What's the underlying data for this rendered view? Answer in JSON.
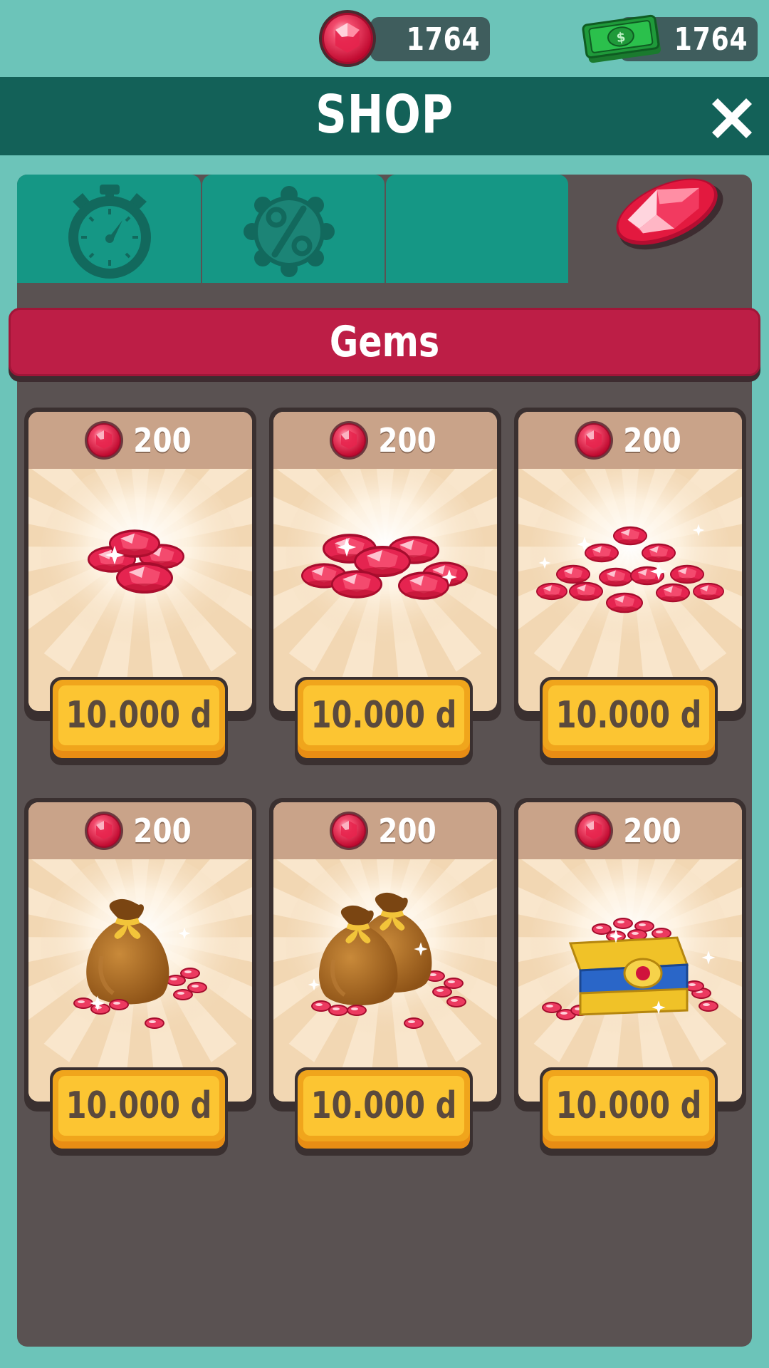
{
  "currency": {
    "gems": "1764",
    "cash": "1764",
    "gem_icon": "ruby-gem-icon",
    "cash_icon": "cash-bills-icon"
  },
  "header": {
    "title": "SHOP",
    "close_icon": "close-icon"
  },
  "tabs": [
    {
      "icon": "stopwatch-icon",
      "active": false
    },
    {
      "icon": "discount-percent-icon",
      "active": false
    },
    {
      "icon": "",
      "active": false
    },
    {
      "icon": "ruby-gem-icon",
      "active": true
    }
  ],
  "section": {
    "title": "Gems"
  },
  "items": [
    {
      "amount": "200",
      "price": "10.000 d",
      "art": "small-gem-pile"
    },
    {
      "amount": "200",
      "price": "10.000 d",
      "art": "medium-gem-pile"
    },
    {
      "amount": "200",
      "price": "10.000 d",
      "art": "large-gem-pile"
    },
    {
      "amount": "200",
      "price": "10.000 d",
      "art": "gem-sack"
    },
    {
      "amount": "200",
      "price": "10.000 d",
      "art": "two-gem-sacks"
    },
    {
      "amount": "200",
      "price": "10.000 d",
      "art": "gem-chest"
    }
  ],
  "colors": {
    "background": "#6cc4b9",
    "title_bar": "#136158",
    "tab": "#159785",
    "panel": "#5a5252",
    "banner": "#bd1e46",
    "card": "#f2d7b3",
    "card_header": "#c9a389",
    "price_button": "#fcc532",
    "gem": "#e0153f"
  }
}
